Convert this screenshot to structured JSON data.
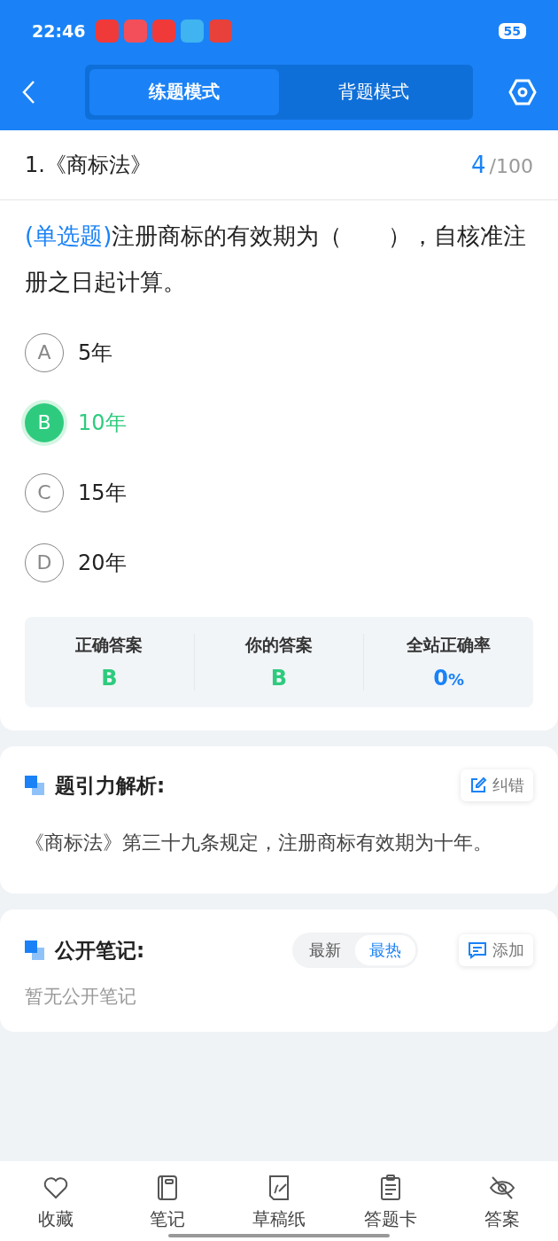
{
  "status_bar": {
    "time": "22:46",
    "battery": "55"
  },
  "header": {
    "tabs": [
      {
        "label": "练题模式",
        "selected": true
      },
      {
        "label": "背题模式",
        "selected": false
      }
    ]
  },
  "question": {
    "title": "1.《商标法》",
    "current": "4",
    "total": "/100",
    "type": "(单选题)",
    "text": "注册商标的有效期为（　　），自核准注册之日起计算。",
    "options": [
      {
        "letter": "A",
        "text": "5年",
        "selected": false
      },
      {
        "letter": "B",
        "text": "10年",
        "selected": true
      },
      {
        "letter": "C",
        "text": "15年",
        "selected": false
      },
      {
        "letter": "D",
        "text": "20年",
        "selected": false
      }
    ]
  },
  "result": [
    {
      "label": "正确答案",
      "value": "B",
      "kind": "answer"
    },
    {
      "label": "你的答案",
      "value": "B",
      "kind": "answer"
    },
    {
      "label": "全站正确率",
      "value": "0",
      "unit": "%",
      "kind": "rate"
    }
  ],
  "analysis": {
    "title": "题引力解析:",
    "button": "纠错",
    "text": "《商标法》第三十九条规定，注册商标有效期为十年。"
  },
  "notes": {
    "title": "公开笔记:",
    "sort": [
      {
        "label": "最新",
        "selected": false
      },
      {
        "label": "最热",
        "selected": true
      }
    ],
    "button": "添加",
    "empty": "暂无公开笔记"
  },
  "bottom_nav": [
    {
      "label": "收藏",
      "kind": "heart"
    },
    {
      "label": "笔记",
      "kind": "notebook"
    },
    {
      "label": "草稿纸",
      "kind": "draft"
    },
    {
      "label": "答题卡",
      "kind": "card"
    },
    {
      "label": "答案",
      "kind": "eye"
    }
  ]
}
